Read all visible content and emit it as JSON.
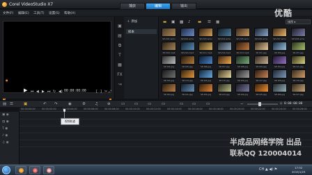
{
  "window": {
    "title": "Corel VideoStudio X7"
  },
  "step_tabs": [
    "捕获",
    "编辑",
    "输出"
  ],
  "active_step": 1,
  "menu": [
    "文件(F)",
    "编辑(E)",
    "工具(T)",
    "设置(S)",
    "帮助(H)"
  ],
  "player": {
    "timecode": "00:00:00:00",
    "progress": 0
  },
  "library": {
    "add_label": "添加",
    "folder_label": "样本",
    "sort_label": "排序",
    "thumbnails": [
      "SP-V01.wmv",
      "SP-V02.wmv",
      "SP-V03.wmv",
      "SP-V04.wmv",
      "SP-V05.wmv",
      "SP-V06.wmv",
      "SP-V07.wmv",
      "SP-V08.wmv",
      "SP-V09.mp4",
      "SP-V10.mp4",
      "SP-V11.mp4",
      "SP-V12.mp4",
      "SP-V13.mp4",
      "SP-I01.jpg",
      "SP-I02.jpg",
      "SP-I03.jpg",
      "SP-I04.jpg",
      "SP-I05.jpg",
      "SP-I06.jpg",
      "SP-I07.jpg",
      "SP-I08.jpg",
      "SP-I09.jpg",
      "SP-I10.jpg",
      "SP-I11.jpg",
      "SP-I12.jpg",
      "SP-I13.jpg",
      "SP-I14.jpg",
      "SP-I15.jpg",
      "SP-I16.jpg",
      "SP-I17.jpg",
      "SP-I18.jpg",
      "SP-I19.jpg",
      "SP-I20.jpg",
      "SP-I21.jpg",
      "SP-I22.jpg",
      "SP-I23.jpg",
      "SP-I24.jpg",
      "SP-I25.jpg",
      "SP-I26.jpg",
      "SP-I27.jpg"
    ],
    "thumb_colors": [
      [
        "#4a3b2a",
        "#b08a58"
      ],
      [
        "#1d2a44",
        "#6a8ac4"
      ],
      [
        "#2c1e10",
        "#d4a05a"
      ],
      [
        "#0f1a22",
        "#4f7c9a"
      ],
      [
        "#3a2a1e",
        "#c99b64"
      ],
      [
        "#1a2230",
        "#8aa7c8"
      ],
      [
        "#402a18",
        "#e6b46c"
      ],
      [
        "#1c1c28",
        "#7c7ca8"
      ],
      [
        "#2a2216",
        "#a8865c"
      ],
      [
        "#10202c",
        "#5c8cb4"
      ],
      [
        "#3a2c14",
        "#d8b060"
      ],
      [
        "#202830",
        "#90a4b8"
      ],
      [
        "#2a1a10",
        "#c07840"
      ],
      [
        "#3c2e20",
        "#e8c89a"
      ],
      [
        "#1a2a3a",
        "#9ac0e0"
      ],
      [
        "#28301a",
        "#a8c070"
      ],
      [
        "#303030",
        "#bcbcbc"
      ],
      [
        "#24180c",
        "#b07c3c"
      ],
      [
        "#0c1c30",
        "#4c84c4"
      ],
      [
        "#3a2410",
        "#f0a850"
      ],
      [
        "#1c2c20",
        "#78a878"
      ],
      [
        "#302820",
        "#c8b090"
      ],
      [
        "#201830",
        "#9070c0"
      ],
      [
        "#2c2c18",
        "#d8d080"
      ],
      [
        "#181818",
        "#707070"
      ],
      [
        "#30200c",
        "#e09840"
      ],
      [
        "#10263a",
        "#68a8e0"
      ],
      [
        "#38301c",
        "#e8d8a0"
      ],
      [
        "#202020",
        "#a0a0a0"
      ],
      [
        "#2a1810",
        "#c88858"
      ],
      [
        "#1c2430",
        "#8098b8"
      ],
      [
        "#342818",
        "#d0a070"
      ],
      [
        "#281c10",
        "#b88048"
      ],
      [
        "#14202c",
        "#6890b8"
      ],
      [
        "#301c0c",
        "#e08838"
      ],
      [
        "#26261a",
        "#b8b888"
      ],
      [
        "#1a1a24",
        "#7878a0"
      ],
      [
        "#38200c",
        "#f09030"
      ],
      [
        "#20282c",
        "#98b0b8"
      ],
      [
        "#2c2418",
        "#c8a878"
      ]
    ]
  },
  "timeline": {
    "timecode": "0:00:00:00",
    "ruler": [
      "00:00:00:00",
      "00:00:02:00",
      "00:00:04:00",
      "00:00:06:00",
      "00:00:08:00",
      "00:00:10:00",
      "00:00:12:00",
      "00:00:14:00",
      "00:00:16:00",
      "00:00:18:00",
      "00:00:20:00",
      "00:00:22:00",
      "00:00:24:00",
      "00:00:26:00"
    ],
    "tooltip": "视频轨道"
  },
  "watermark": {
    "logo": "优酷",
    "line1": "半成品网络学院 出品",
    "line2": "联系QQ 120004014"
  },
  "taskbar": {
    "time": "17:52",
    "date": "2015/1/23",
    "tray": "CH ▲ ◀) ⚑"
  }
}
